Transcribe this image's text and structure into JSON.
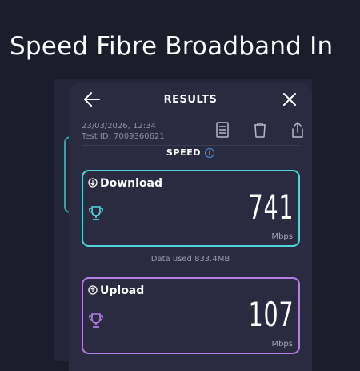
{
  "headline": "Speed Fibre Broadband In",
  "header": {
    "title": "RESULTS"
  },
  "test": {
    "timestamp": "23/03/2026, 12:34",
    "test_id": "Test ID: 7009360621"
  },
  "section": {
    "label": "SPEED"
  },
  "download": {
    "label": "Download",
    "value": "741",
    "unit": "Mbps",
    "accent": "#4fd6da"
  },
  "data_used": "Data used 833.4MB",
  "upload": {
    "label": "Upload",
    "value": "107",
    "unit": "Mbps",
    "accent": "#b57ee6"
  },
  "icons": [
    "back-arrow-icon",
    "close-icon",
    "report-icon",
    "trash-icon",
    "share-icon",
    "info-icon",
    "download-arrow-icon",
    "upload-arrow-icon",
    "trophy-icon"
  ]
}
